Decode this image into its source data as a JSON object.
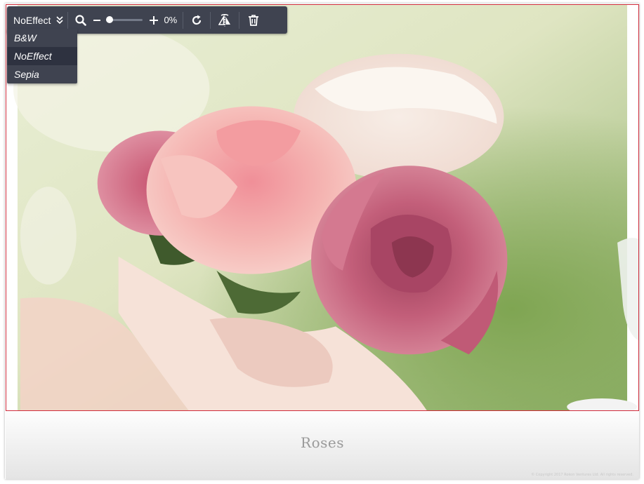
{
  "toolbar": {
    "effect_select": {
      "selected": "NoEffect"
    },
    "zoom": {
      "value_text": "0%",
      "level": 0
    },
    "icons": {
      "dropdown": "double-chevron-down-icon",
      "zoom": "magnifier-icon",
      "zoom_out": "minus-icon",
      "zoom_in": "plus-icon",
      "rotate": "rotate-icon",
      "flip": "flip-horizontal-icon",
      "delete": "trash-icon"
    }
  },
  "dropdown": {
    "items": [
      {
        "label": "B&W",
        "selected": false
      },
      {
        "label": "NoEffect",
        "selected": true
      },
      {
        "label": "Sepia",
        "selected": false
      }
    ]
  },
  "image": {
    "subject": "pink and white roses in a bouquet"
  },
  "caption": {
    "text": "Roses"
  },
  "footer": {
    "copyright": "© Copyright 2017 Rokon Ventures Ltd. All rights reserved."
  },
  "colors": {
    "frame_border": "#cf2a3a",
    "toolbar_bg": "#3f4350",
    "caption_text": "#9a9a9a"
  }
}
